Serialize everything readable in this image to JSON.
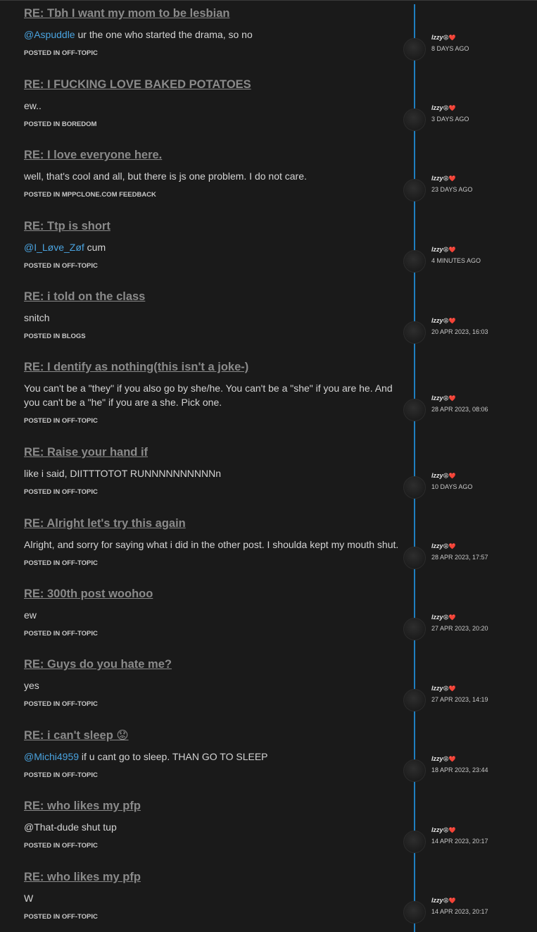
{
  "author": {
    "name": "Izzy",
    "badges": "😩❤️"
  },
  "posted_prefix": "POSTED IN",
  "posts": [
    {
      "title": "RE: Tbh I want my mom to be lesbian",
      "mention": "@Aspuddle",
      "text": " ur the one who started the drama, so no",
      "category": "OFF-TOPIC",
      "date": "8 DAYS AGO"
    },
    {
      "title": "RE: I FUCKING LOVE BAKED POTATOES",
      "mention": "",
      "text": "ew..",
      "category": "BOREDOM",
      "date": "3 DAYS AGO"
    },
    {
      "title": "RE: I love everyone here.",
      "mention": "",
      "text": "well, that's cool and all, but there is js one problem. I do not care.",
      "category": "MPPCLONE.COM FEEDBACK",
      "date": "23 DAYS AGO"
    },
    {
      "title": "RE: Ttp is short",
      "mention": "@I_Løve_Zøf",
      "text": " cum",
      "category": "OFF-TOPIC",
      "date": "4 MINUTES AGO"
    },
    {
      "title": "RE: i told on the class",
      "mention": "",
      "text": "snitch",
      "category": "BLOGS",
      "date": "20 APR 2023, 16:03"
    },
    {
      "title": "RE: I dentify as nothing(this isn't a joke-)",
      "mention": "",
      "text": "You can't be a \"they\" if you also go by she/he. You can't be a \"she\" if you are he. And you can't be a \"he\" if you are a she. Pick one.",
      "category": "OFF-TOPIC",
      "date": "28 APR 2023, 08:06"
    },
    {
      "title": "RE: Raise your hand if",
      "mention": "",
      "text": "like i said, DIITTTOTOT RUNNNNNNNNNNn",
      "category": "OFF-TOPIC",
      "date": "10 DAYS AGO"
    },
    {
      "title": "RE: Alright let's try this again",
      "mention": "",
      "text": "Alright, and sorry for saying what i did in the other post. I shoulda kept my mouth shut.",
      "category": "OFF-TOPIC",
      "date": "28 APR 2023, 17:57"
    },
    {
      "title": "RE: 300th post woohoo",
      "mention": "",
      "text": "ew",
      "category": "OFF-TOPIC",
      "date": "27 APR 2023, 20:20"
    },
    {
      "title": "RE: Guys do you hate me?",
      "mention": "",
      "text": "yes",
      "category": "OFF-TOPIC",
      "date": "27 APR 2023, 14:19"
    },
    {
      "title": "RE: i can't sleep 😟",
      "mention": "@Michi4959",
      "text": " if u cant go to sleep. THAN GO TO SLEEP",
      "category": "OFF-TOPIC",
      "date": "18 APR 2023, 23:44"
    },
    {
      "title": "RE: who likes my pfp",
      "mention": "",
      "text": "@That-dude shut tup",
      "category": "OFF-TOPIC",
      "date": "14 APR 2023, 20:17"
    },
    {
      "title": "RE: who likes my pfp",
      "mention": "",
      "text": "W",
      "category": "OFF-TOPIC",
      "date": "14 APR 2023, 20:17"
    }
  ]
}
